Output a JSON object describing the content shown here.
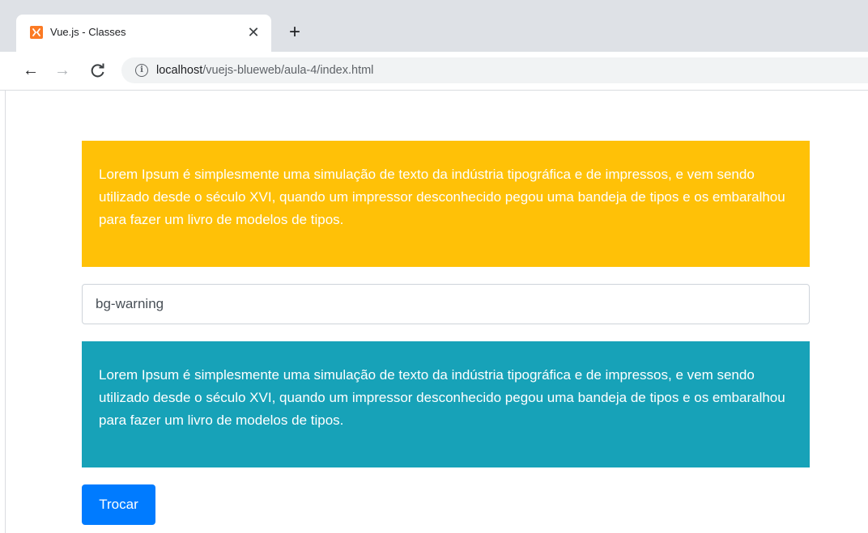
{
  "browser": {
    "tab": {
      "title": "Vue.js - Classes",
      "close_glyph": "✕",
      "favicon": "xampp-icon"
    },
    "new_tab_glyph": "+",
    "nav": {
      "back_glyph": "←",
      "forward_glyph": "→",
      "reload_glyph": "C"
    },
    "address": {
      "info_glyph": "i",
      "host": "localhost",
      "path": "/vuejs-blueweb/aula-4/index.html"
    }
  },
  "page": {
    "top_box": {
      "text": "Lorem Ipsum é simplesmente uma simulação de texto da indústria tipográfica e de impressos, e vem sendo utilizado desde o século XVI, quando um impressor desconhecido pegou uma bandeja de tipos e os embaralhou para fazer um livro de modelos de tipos.",
      "color": "#ffc107"
    },
    "class_input": {
      "value": "bg-warning"
    },
    "bottom_box": {
      "text": "Lorem Ipsum é simplesmente uma simulação de texto da indústria tipográfica e de impressos, e vem sendo utilizado desde o século XVI, quando um impressor desconhecido pegou uma bandeja de tipos e os embaralhou para fazer um livro de modelos de tipos.",
      "color": "#17a2b8"
    },
    "swap_button": {
      "label": "Trocar",
      "color": "#007bff"
    }
  }
}
